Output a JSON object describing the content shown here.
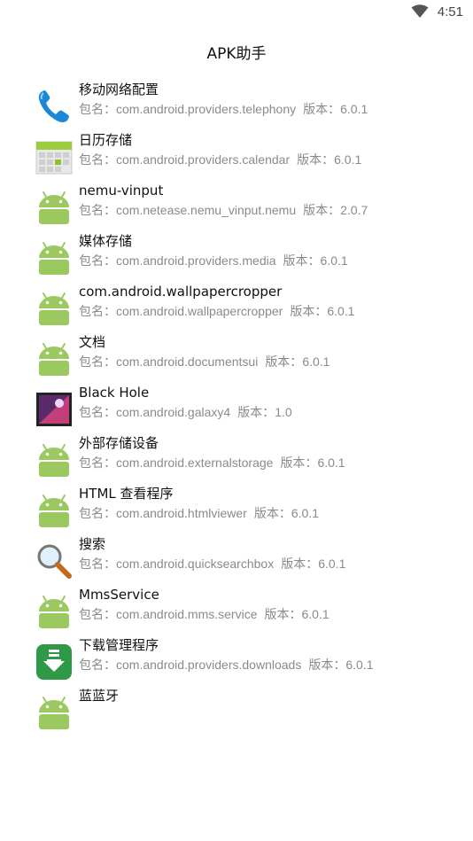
{
  "status": {
    "time": "4:51"
  },
  "toolbar": {
    "title": "APK助手"
  },
  "labels": {
    "pkg": "包名：",
    "ver": "版本："
  },
  "apps": [
    {
      "name": "移动网络配置",
      "pkg": "com.android.providers.telephony",
      "version": "6.0.1",
      "icon": "phone"
    },
    {
      "name": "日历存储",
      "pkg": "com.android.providers.calendar",
      "version": "6.0.1",
      "icon": "calendar"
    },
    {
      "name": "nemu-vinput",
      "pkg": "com.netease.nemu_vinput.nemu",
      "version": "2.0.7",
      "icon": "android"
    },
    {
      "name": "媒体存储",
      "pkg": "com.android.providers.media",
      "version": "6.0.1",
      "icon": "android"
    },
    {
      "name": "com.android.wallpapercropper",
      "pkg": "com.android.wallpapercropper",
      "version": "6.0.1",
      "icon": "android"
    },
    {
      "name": "文档",
      "pkg": "com.android.documentsui",
      "version": "6.0.1",
      "icon": "android"
    },
    {
      "name": "Black Hole",
      "pkg": "com.android.galaxy4",
      "version": "1.0",
      "icon": "picture"
    },
    {
      "name": "外部存储设备",
      "pkg": "com.android.externalstorage",
      "version": "6.0.1",
      "icon": "android"
    },
    {
      "name": "HTML 查看程序",
      "pkg": "com.android.htmlviewer",
      "version": "6.0.1",
      "icon": "android"
    },
    {
      "name": "搜索",
      "pkg": "com.android.quicksearchbox",
      "version": "6.0.1",
      "icon": "search"
    },
    {
      "name": "MmsService",
      "pkg": "com.android.mms.service",
      "version": "6.0.1",
      "icon": "android"
    },
    {
      "name": "下载管理程序",
      "pkg": "com.android.providers.downloads",
      "version": "6.0.1",
      "icon": "download"
    },
    {
      "name": "蓝蓝牙",
      "pkg": "",
      "version": "",
      "icon": "android"
    }
  ]
}
